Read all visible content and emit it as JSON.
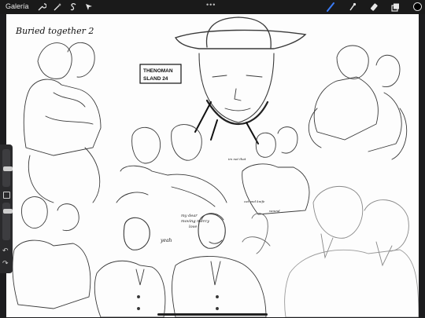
{
  "app": {
    "gallery_label": "Galería",
    "tools_left": [
      "wrench-icon",
      "magic-wand-icon",
      "selection-s-icon",
      "move-arrow-icon"
    ],
    "tools_right": [
      "brush-icon",
      "smudge-icon",
      "eraser-icon",
      "layers-icon"
    ],
    "active_tool": "brush-icon",
    "current_color": "#000000",
    "more_menu": "•••"
  },
  "canvas": {
    "caption_top_left": "Buried together 2",
    "sign_line1": "THENOMAN",
    "sign_line2": "SLAND 24",
    "speech_small": "yeah",
    "speech_center_1": "my dear",
    "speech_center_2": "moving mercy",
    "speech_center_3": "love",
    "note_right_1": "cat and knife",
    "note_right_2": "wound",
    "note_mid_small": "im not that"
  },
  "sidebar": {
    "undo_label": "↶",
    "redo_label": "↷"
  }
}
